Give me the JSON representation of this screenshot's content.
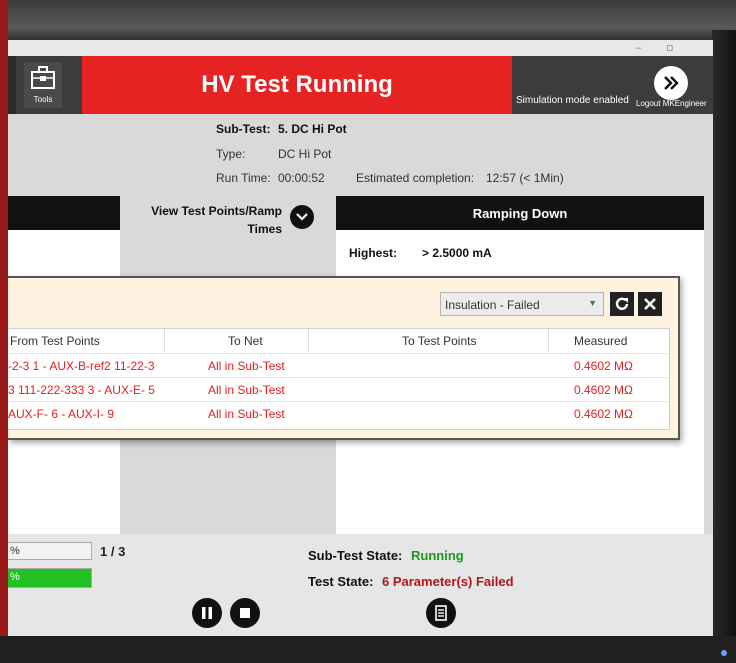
{
  "window": {
    "minimize": "–",
    "maximize": "▫"
  },
  "header": {
    "tools_label": "Tools",
    "status_banner": "HV Test Running",
    "simulation_text": "Simulation mode enabled",
    "logout_label": "Logout MKEngineer"
  },
  "test_info": {
    "subtest_label": "Sub-Test:",
    "subtest_value": "5. DC Hi Pot",
    "type_label": "Type:",
    "type_value": "DC Hi Pot",
    "runtime_label": "Run Time:",
    "runtime_value": "00:00:52",
    "completion_label": "Estimated completion:",
    "completion_value": "12:57 (< 1Min)"
  },
  "view_test_points": {
    "line1": "View Test Points/Ramp",
    "line2": "Times"
  },
  "ramp_panel": {
    "title": "Ramping Down",
    "highest_label": "Highest:",
    "highest_value": "> 2.5000 mA"
  },
  "results": {
    "filter": "Insulation - Failed",
    "columns": {
      "from_tp": "From Test Points",
      "to_net": "To Net",
      "to_tp": "To Test Points",
      "measured": "Measured"
    },
    "rows": [
      {
        "from_tp": "-2-3 1 - AUX-B-ref2 11-22-3",
        "to_net": "All in Sub-Test",
        "to_tp": "",
        "measured": "0.4602 MΩ"
      },
      {
        "from_tp": "3 111-222-333 3 - AUX-E- 5",
        "to_net": "All in Sub-Test",
        "to_tp": "",
        "measured": "0.4602 MΩ"
      },
      {
        "from_tp": "AUX-F- 6 - AUX-I- 9",
        "to_net": "All in Sub-Test",
        "to_tp": "",
        "measured": "0.4602 MΩ"
      }
    ]
  },
  "footer": {
    "progress1_text": "%",
    "progress2_text": "%",
    "progress2_fraction": 1.0,
    "step_counter": "1 / 3",
    "subtest_state_label": "Sub-Test State:",
    "subtest_state_value": "Running",
    "test_state_label": "Test State:",
    "test_state_value": "6 Parameter(s) Failed"
  },
  "colors": {
    "banner": "#e62222",
    "failed_text": "#e02020",
    "running": "#1a9a1a",
    "test_failed": "#b01818"
  },
  "icons": [
    "tools-icon",
    "logout-icon",
    "chevron-down-icon",
    "refresh-icon",
    "close-icon",
    "pause-icon",
    "stop-icon",
    "report-icon"
  ]
}
